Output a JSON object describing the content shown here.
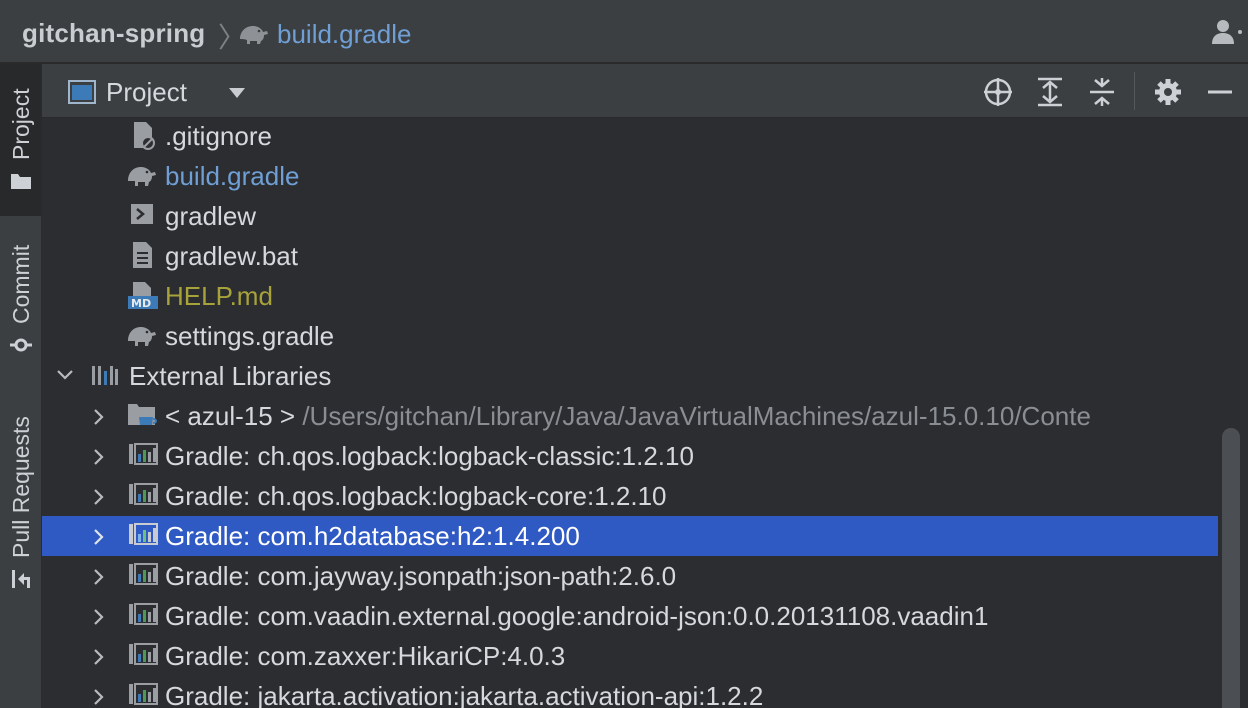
{
  "breadcrumb": {
    "project": "gitchan-spring",
    "separator": "〉",
    "file": "build.gradle"
  },
  "toolstrip": {
    "project_label": "Project",
    "commit_label": "Commit",
    "pull_requests_label": "Pull Requests"
  },
  "panel": {
    "title": "Project",
    "tools": [
      "locate-icon",
      "expand-all-icon",
      "collapse-all-icon",
      "gear-icon",
      "minimize-icon"
    ]
  },
  "tree": {
    "files": [
      {
        "name": ".gitignore",
        "icon": "ignore-file-icon",
        "color": "#d5d8dc"
      },
      {
        "name": "build.gradle",
        "icon": "gradle-elephant-icon",
        "color": "#6f9fd4"
      },
      {
        "name": "gradlew",
        "icon": "shell-script-icon",
        "color": "#d5d8dc"
      },
      {
        "name": "gradlew.bat",
        "icon": "text-file-icon",
        "color": "#d5d8dc"
      },
      {
        "name": "HELP.md",
        "icon": "markdown-file-icon",
        "color": "#a8a23a"
      },
      {
        "name": "settings.gradle",
        "icon": "gradle-elephant-icon",
        "color": "#d5d8dc"
      }
    ],
    "external_libraries": {
      "label": "External Libraries",
      "sdk": {
        "name": "< azul-15 >",
        "path": "/Users/gitchan/Library/Java/JavaVirtualMachines/azul-15.0.10/Conte"
      },
      "libraries": [
        {
          "name": "Gradle: ch.qos.logback:logback-classic:1.2.10",
          "selected": false
        },
        {
          "name": "Gradle: ch.qos.logback:logback-core:1.2.10",
          "selected": false
        },
        {
          "name": "Gradle: com.h2database:h2:1.4.200",
          "selected": true
        },
        {
          "name": "Gradle: com.jayway.jsonpath:json-path:2.6.0",
          "selected": false
        },
        {
          "name": "Gradle: com.vaadin.external.google:android-json:0.0.20131108.vaadin1",
          "selected": false
        },
        {
          "name": "Gradle: com.zaxxer:HikariCP:4.0.3",
          "selected": false
        },
        {
          "name": "Gradle: jakarta.activation:jakarta.activation-api:1.2.2",
          "selected": false
        }
      ]
    }
  },
  "colors": {
    "selection": "#2f5ac4",
    "link_blue": "#6f9fd4",
    "markdown_olive": "#a8a23a",
    "path_gray": "#8a8e93"
  }
}
